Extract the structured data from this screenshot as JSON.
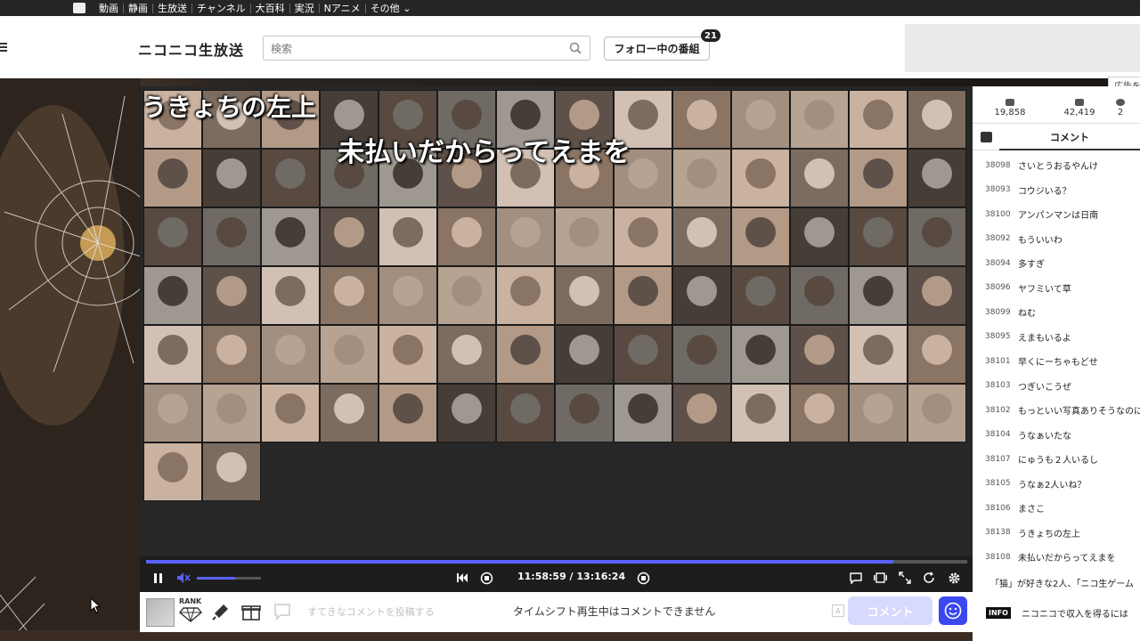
{
  "topnav": {
    "items": [
      "動画",
      "静画",
      "生放送",
      "チャンネル",
      "大百科",
      "実況",
      "Nアニメ",
      "その他"
    ]
  },
  "header": {
    "site_title": "ニコニコ生放送",
    "search_placeholder": "検索",
    "follow_button": "フォロー中の番組",
    "follow_count": "21"
  },
  "ad_tag": "広告を",
  "video": {
    "overlay_line1": "うきょちの左上",
    "overlay_line2": "未払いだからってえまを"
  },
  "player": {
    "time": "11:58:59 / 13:16:24",
    "progress": 0.91,
    "volume": 0.6
  },
  "comment_bar": {
    "rank_label": "RANK",
    "placeholder": "すてきなコメントを投稿する",
    "disabled_message": "タイムシフト再生中はコメントできません",
    "submit": "コメント"
  },
  "side": {
    "stats": {
      "viewers": "19,858",
      "comments": "42,419",
      "ads": "2"
    },
    "tab_label": "コメント",
    "comments": [
      {
        "no": "38098",
        "text": "さいとうおるやんけ"
      },
      {
        "no": "38093",
        "text": "コウジいる？"
      },
      {
        "no": "38100",
        "text": "アンパンマンは日南"
      },
      {
        "no": "38092",
        "text": "もういいわ"
      },
      {
        "no": "38094",
        "text": "多すぎ"
      },
      {
        "no": "38096",
        "text": "ヤフミいて草"
      },
      {
        "no": "38099",
        "text": "ねむ"
      },
      {
        "no": "38095",
        "text": "えまもいるよ"
      },
      {
        "no": "38101",
        "text": "早くにーちゃもどせ"
      },
      {
        "no": "38103",
        "text": "つぎいこうぜ"
      },
      {
        "no": "38102",
        "text": "もっといい写真ありそうなのに"
      },
      {
        "no": "38104",
        "text": "うなぁいたな"
      },
      {
        "no": "38107",
        "text": "にゅうも２人いるし"
      },
      {
        "no": "38105",
        "text": "うなぁ2人いね？"
      },
      {
        "no": "38106",
        "text": "まさこ"
      },
      {
        "no": "38138",
        "text": "うきょちの左上"
      },
      {
        "no": "38108",
        "text": "未払いだからってえまを"
      }
    ],
    "marquee": "「猫」が好きな2人、「ニコ生ゲーム",
    "info_badge": "INFO",
    "info_text": "ニコニコで収入を得るには"
  }
}
